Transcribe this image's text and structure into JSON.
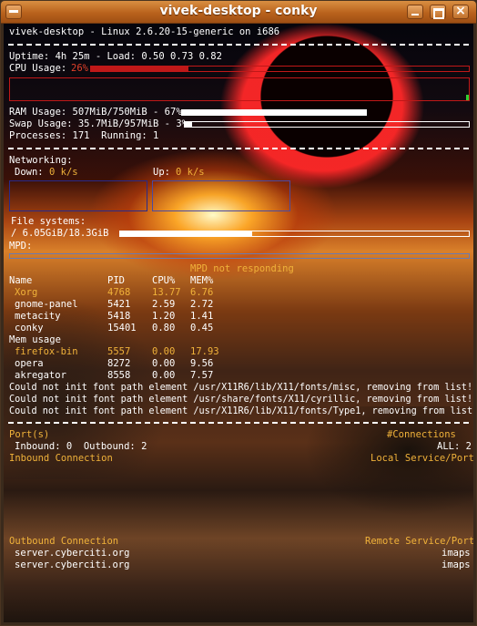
{
  "window": {
    "title": "vivek-desktop - conky"
  },
  "header": {
    "host_line": "vivek-desktop - Linux 2.6.20-15-generic on i686"
  },
  "system": {
    "uptime_line": "Uptime: 4h 25m - Load: 0.50 0.73 0.82",
    "cpu_label": "CPU Usage:",
    "cpu_value": "26%",
    "cpu_percent": 26,
    "ram_line": "RAM Usage: 507MiB/750MiB - 67%",
    "ram_percent": 67,
    "swap_line": "Swap Usage: 35.7MiB/957MiB - 3%",
    "swap_percent": 3,
    "processes_line": "Processes: 171  Running: 1"
  },
  "network": {
    "heading": "Networking:",
    "down_label": "Down:",
    "down_value": "0 k/s",
    "up_label": "Up:",
    "up_value": "0 k/s"
  },
  "filesystems": {
    "heading": "File systems:",
    "root_line": "/ 6.05GiB/18.3GiB",
    "root_percent": 33
  },
  "mpd": {
    "heading": "MPD:",
    "status": "MPD not responding"
  },
  "top_cpu": {
    "headers": [
      "Name",
      "PID",
      "CPU%",
      "MEM%"
    ],
    "rows": [
      {
        "name": "Xorg",
        "pid": "4768",
        "cpu": "13.77",
        "mem": "6.76"
      },
      {
        "name": "gnome-panel",
        "pid": "5421",
        "cpu": "2.59",
        "mem": "2.72"
      },
      {
        "name": "metacity",
        "pid": "5418",
        "cpu": "1.20",
        "mem": "1.41"
      },
      {
        "name": "conky",
        "pid": "15401",
        "cpu": "0.80",
        "mem": "0.45"
      }
    ]
  },
  "top_mem": {
    "heading": "Mem usage",
    "rows": [
      {
        "name": "firefox-bin",
        "pid": "5557",
        "cpu": "0.00",
        "mem": "17.93"
      },
      {
        "name": "opera",
        "pid": "8272",
        "cpu": "0.00",
        "mem": "9.56"
      },
      {
        "name": "akregator",
        "pid": "8558",
        "cpu": "0.00",
        "mem": "7.57"
      }
    ]
  },
  "errors": [
    "Could not init font path element /usr/X11R6/lib/X11/fonts/misc, removing from list!",
    "Could not init font path element /usr/share/fonts/X11/cyrillic, removing from list!",
    "Could not init font path element /usr/X11R6/lib/X11/fonts/Type1, removing from list!"
  ],
  "ports": {
    "heading": "Port(s)",
    "connections_label": "#Connections",
    "inbound_line": "Inbound: 0  Outbound: 2",
    "all_line": "ALL: 2",
    "inbound_connection": "Inbound Connection",
    "local_service": "Local Service/Port",
    "outbound_connection": "Outbound Connection",
    "remote_service": "Remote Service/Port",
    "outbound_rows": [
      {
        "host": "server.cyberciti.org",
        "service": "imaps"
      },
      {
        "host": "server.cyberciti.org",
        "service": "imaps"
      }
    ]
  },
  "colors": {
    "accent_orange": "#f0b23a",
    "accent_red": "#e0402a",
    "text": "#ffffff",
    "titlebar": "#c0702a"
  }
}
